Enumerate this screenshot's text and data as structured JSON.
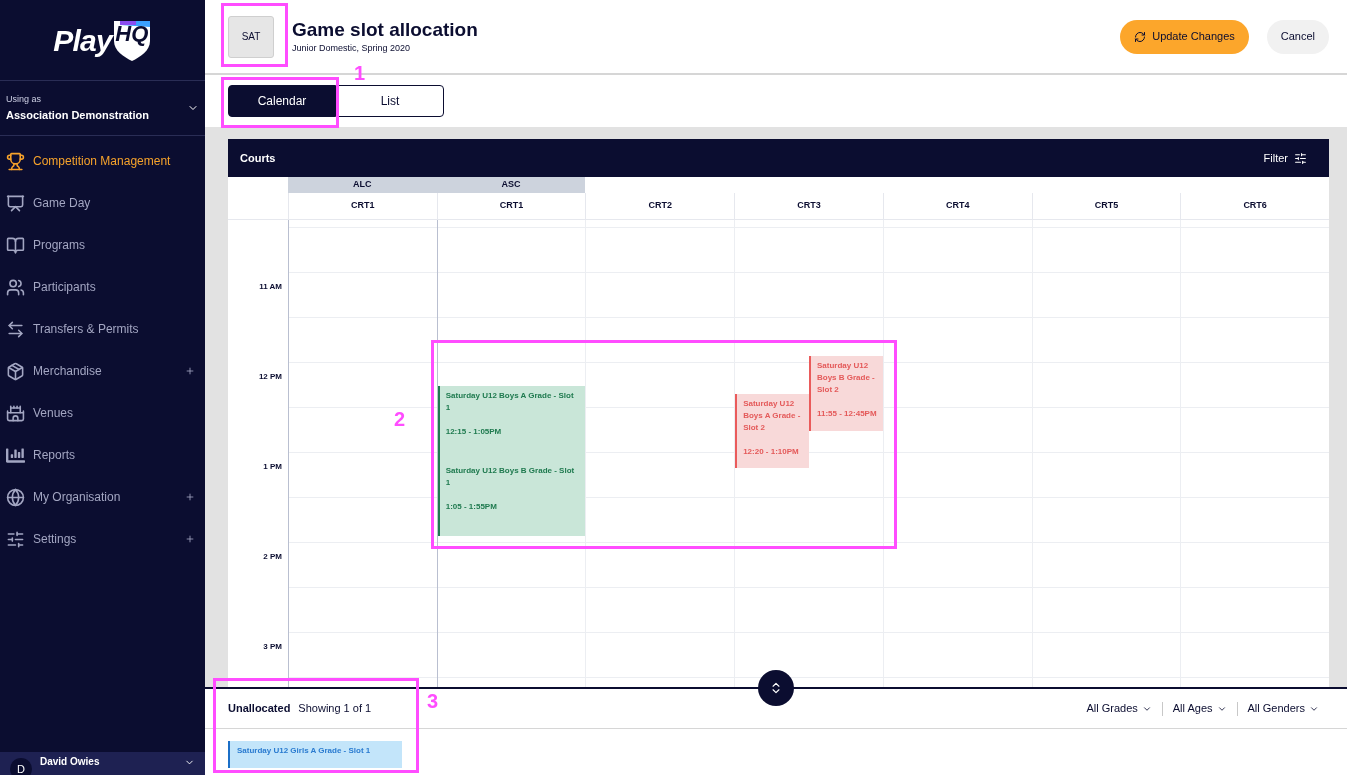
{
  "sidebar": {
    "logo": {
      "left": "Play",
      "right": "HQ"
    },
    "account": {
      "caption": "Using as",
      "name": "Association Demonstration"
    },
    "items": [
      {
        "label": "Competition Management",
        "selected": true,
        "expandable": false
      },
      {
        "label": "Game Day",
        "selected": false,
        "expandable": false
      },
      {
        "label": "Programs",
        "selected": false,
        "expandable": false
      },
      {
        "label": "Participants",
        "selected": false,
        "expandable": false
      },
      {
        "label": "Transfers & Permits",
        "selected": false,
        "expandable": false
      },
      {
        "label": "Merchandise",
        "selected": false,
        "expandable": true
      },
      {
        "label": "Venues",
        "selected": false,
        "expandable": false
      },
      {
        "label": "Reports",
        "selected": false,
        "expandable": false
      },
      {
        "label": "My Organisation",
        "selected": false,
        "expandable": true
      },
      {
        "label": "Settings",
        "selected": false,
        "expandable": true
      }
    ],
    "user": {
      "initial": "D",
      "name": "David Owies"
    }
  },
  "header": {
    "day": "SAT",
    "title": "Game slot allocation",
    "subtitle": "Junior Domestic, Spring 2020",
    "buttons": [
      {
        "label": "Update Changes",
        "kind": "primary"
      },
      {
        "label": "Cancel",
        "kind": "secondary"
      }
    ]
  },
  "tabs": [
    {
      "label": "Calendar",
      "selected": true
    },
    {
      "label": "List",
      "selected": false
    }
  ],
  "calendar": {
    "title": "Courts",
    "filter": "Filter",
    "times": [
      "11 AM",
      "12 PM",
      "1 PM",
      "2 PM",
      "3 PM"
    ],
    "courts": [
      {
        "group": "ALC",
        "name": "CRT1"
      },
      {
        "group": "ASC",
        "name": "CRT1",
        "events": [
          {
            "title": "Saturday U12 Boys A Grade - Slot 1",
            "time": "12:15 - 1:05PM",
            "kind": "ok"
          },
          {
            "title": "Saturday U12 Boys B Grade - Slot 1",
            "time": "1:05 - 1:55PM",
            "kind": "ok"
          }
        ]
      },
      {
        "name": "CRT2"
      },
      {
        "name": "CRT3",
        "events": [
          {
            "title": "Saturday U12 Boys A Grade - Slot 2",
            "time": "12:20 - 1:10PM",
            "kind": "clash"
          },
          {
            "title": "Saturday U12 Boys B Grade - Slot 2",
            "time": "11:55 - 12:45PM",
            "kind": "clash"
          }
        ]
      },
      {
        "name": "CRT4"
      },
      {
        "name": "CRT5"
      },
      {
        "name": "CRT6"
      }
    ]
  },
  "unallocated": {
    "title": "Unallocated",
    "count": "Showing 1 of 1",
    "filters": [
      "All Grades",
      "All Ages",
      "All Genders"
    ],
    "items": [
      {
        "title": "Saturday U12 Girls A Grade - Slot 1"
      }
    ]
  },
  "annotations": [
    {
      "kind": "frame"
    },
    {
      "label": "1"
    },
    {
      "label": "2"
    },
    {
      "label": "3"
    }
  ]
}
